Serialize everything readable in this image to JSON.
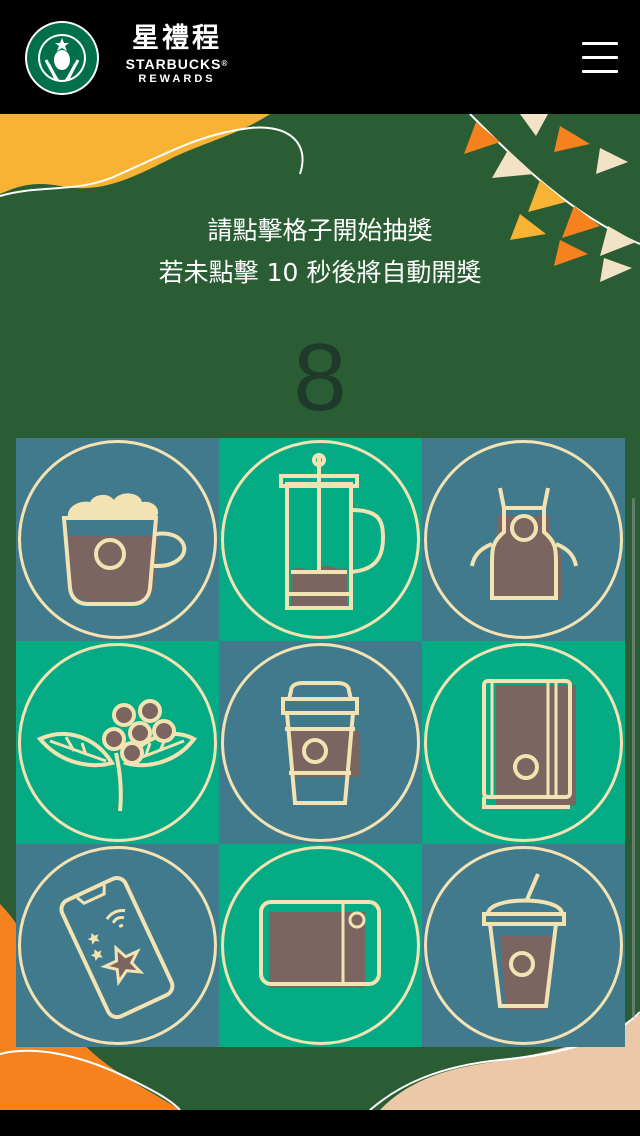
{
  "header": {
    "brand_zh": "星禮程",
    "brand_en": "STARBUCKS",
    "brand_trademark": "®",
    "brand_sub": "REWARDS",
    "logo_icon": "starbucks-siren-logo",
    "menu_icon": "hamburger-menu-icon"
  },
  "game": {
    "instruction_line1": "請點擊格子開始抽獎",
    "instruction_line2": "若未點擊 10 秒後將自動開獎",
    "countdown": "8",
    "cells": [
      {
        "icon": "latte-cup-icon",
        "color": "blue"
      },
      {
        "icon": "french-press-icon",
        "color": "green"
      },
      {
        "icon": "apron-icon",
        "color": "blue"
      },
      {
        "icon": "coffee-cherry-branch-icon",
        "color": "green"
      },
      {
        "icon": "to-go-cup-icon",
        "color": "blue"
      },
      {
        "icon": "notebook-icon",
        "color": "green"
      },
      {
        "icon": "mobile-phone-star-icon",
        "color": "blue"
      },
      {
        "icon": "gift-card-icon",
        "color": "green"
      },
      {
        "icon": "frappuccino-cup-icon",
        "color": "blue"
      }
    ]
  },
  "colors": {
    "background": "#2a5d34",
    "cell_blue": "#427a8d",
    "cell_green": "#05ab85",
    "icon_line": "#f3e3b2",
    "icon_fill": "#7c6560",
    "header": "#000000",
    "accent_orange": "#f5821f",
    "accent_yellow": "#f9b334",
    "accent_peach": "#ebc9a8"
  }
}
